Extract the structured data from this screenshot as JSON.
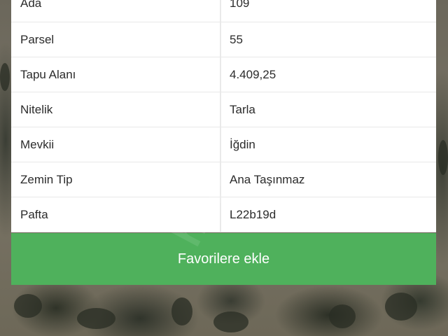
{
  "parcel_info": {
    "rows": [
      {
        "label": "Ada",
        "value": "109"
      },
      {
        "label": "Parsel",
        "value": "55"
      },
      {
        "label": "Tapu Alanı",
        "value": "4.409,25"
      },
      {
        "label": "Nitelik",
        "value": "Tarla"
      },
      {
        "label": "Mevkii",
        "value": "İğdin"
      },
      {
        "label": "Zemin Tip",
        "value": "Ana Taşınmaz"
      },
      {
        "label": "Pafta",
        "value": "L22b19d"
      }
    ]
  },
  "actions": {
    "favorite_label": "Favorilere ekle"
  },
  "colors": {
    "button": "#4fb15c",
    "panel_bg": "#ffffff",
    "divider": "#e9e9e9"
  }
}
